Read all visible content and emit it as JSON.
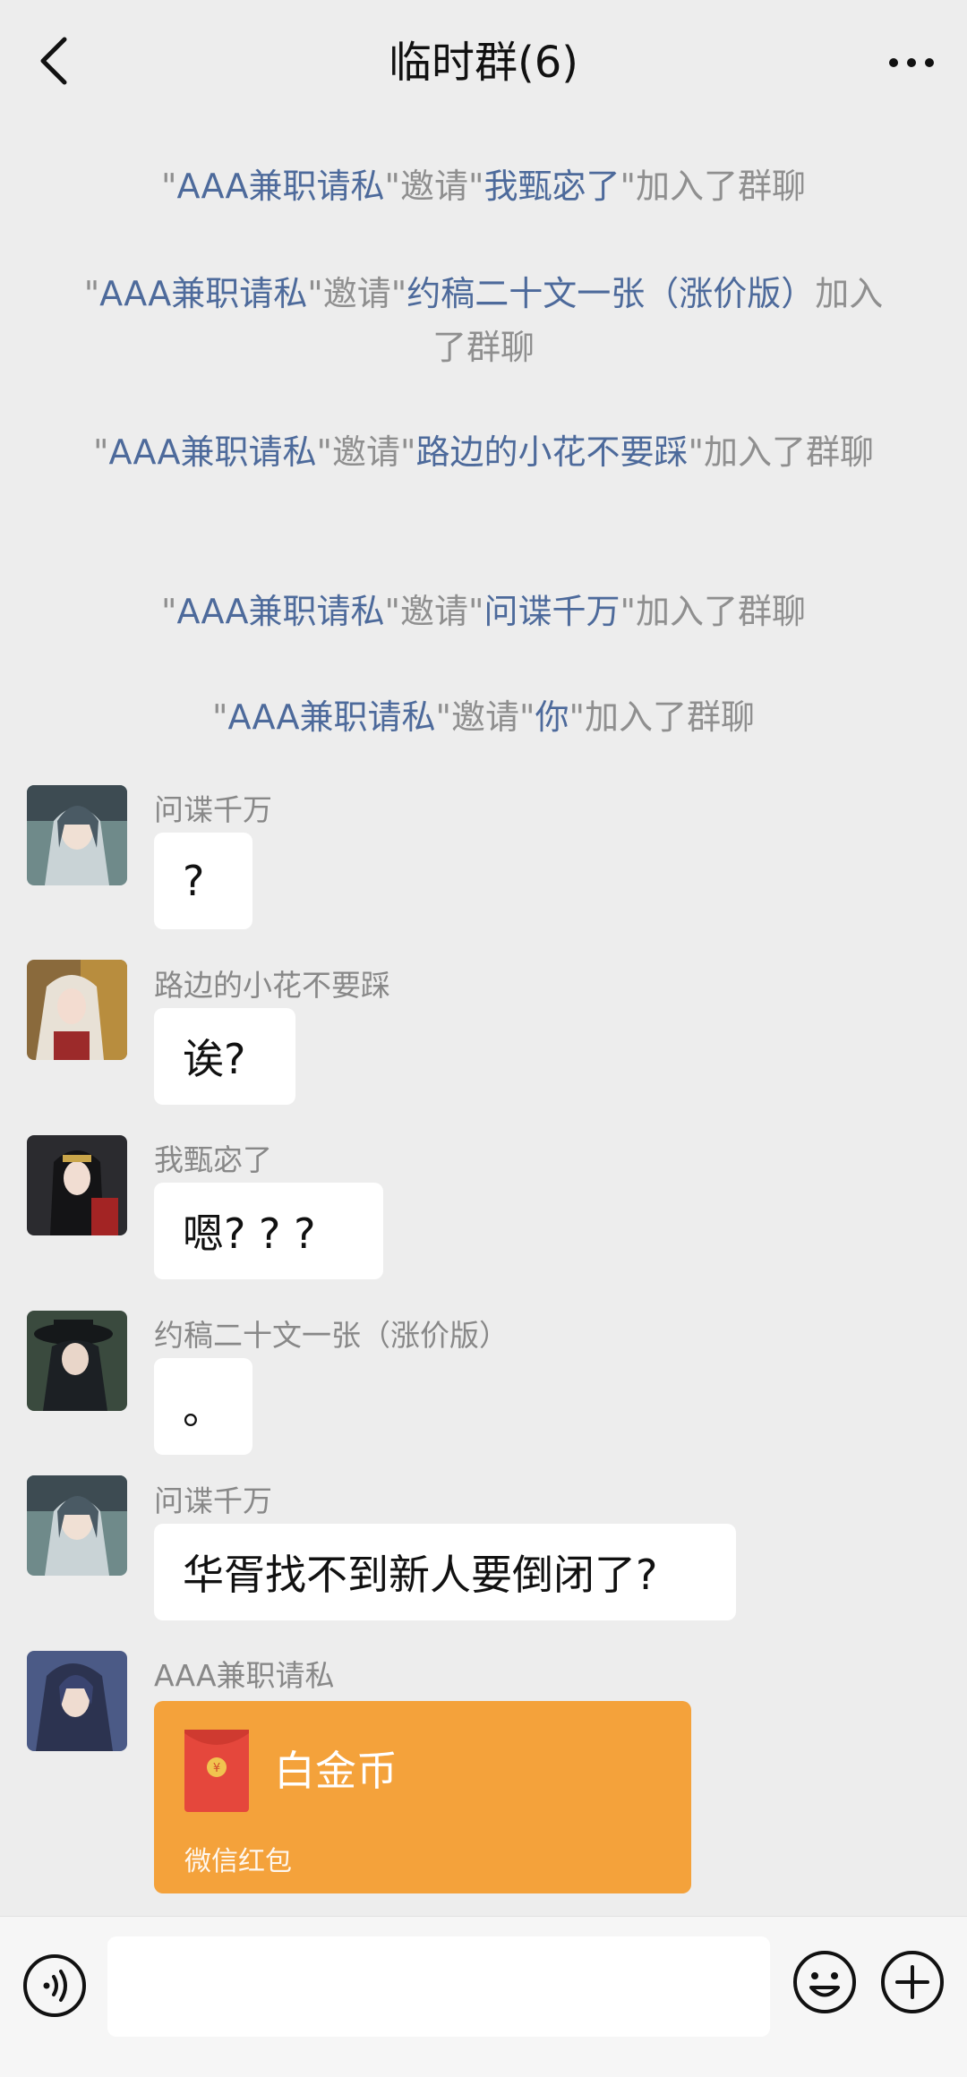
{
  "header": {
    "title": "临时群(6)"
  },
  "system_messages": [
    {
      "inviter": "AAA兼职请私",
      "verb": "邀请",
      "invitee": "我甄宓了",
      "suffix": "加入了群聊"
    },
    {
      "inviter": "AAA兼职请私",
      "verb": "邀请",
      "invitee": "约稿二十文一张（涨价版）",
      "suffix": "加入了群聊"
    },
    {
      "inviter": "AAA兼职请私",
      "verb": "邀请",
      "invitee": "路边的小花不要踩",
      "suffix": "加入了群聊"
    },
    {
      "inviter": "AAA兼职请私",
      "verb": "邀请",
      "invitee": "问谍千万",
      "suffix": "加入了群聊"
    },
    {
      "inviter": "AAA兼职请私",
      "verb": "邀请",
      "invitee": "你",
      "suffix": "加入了群聊"
    }
  ],
  "messages": [
    {
      "sender": "问谍千万",
      "text": "?"
    },
    {
      "sender": "路边的小花不要踩",
      "text": "诶?"
    },
    {
      "sender": "我甄宓了",
      "text": "嗯? ? ?"
    },
    {
      "sender": "约稿二十文一张（涨价版）",
      "text": "。"
    },
    {
      "sender": "问谍千万",
      "text": "华胥找不到新人要倒闭了?"
    },
    {
      "sender": "AAA兼职请私"
    }
  ],
  "red_packet": {
    "title": "白金币",
    "label": "微信红包",
    "color": "#f4a23b"
  },
  "input": {
    "placeholder": ""
  },
  "icons": {
    "back": "chevron-left-icon",
    "more": "more-dots-icon",
    "voice": "voice-icon",
    "emoji": "emoji-icon",
    "plus": "plus-icon",
    "red_packet": "red-packet-icon"
  }
}
